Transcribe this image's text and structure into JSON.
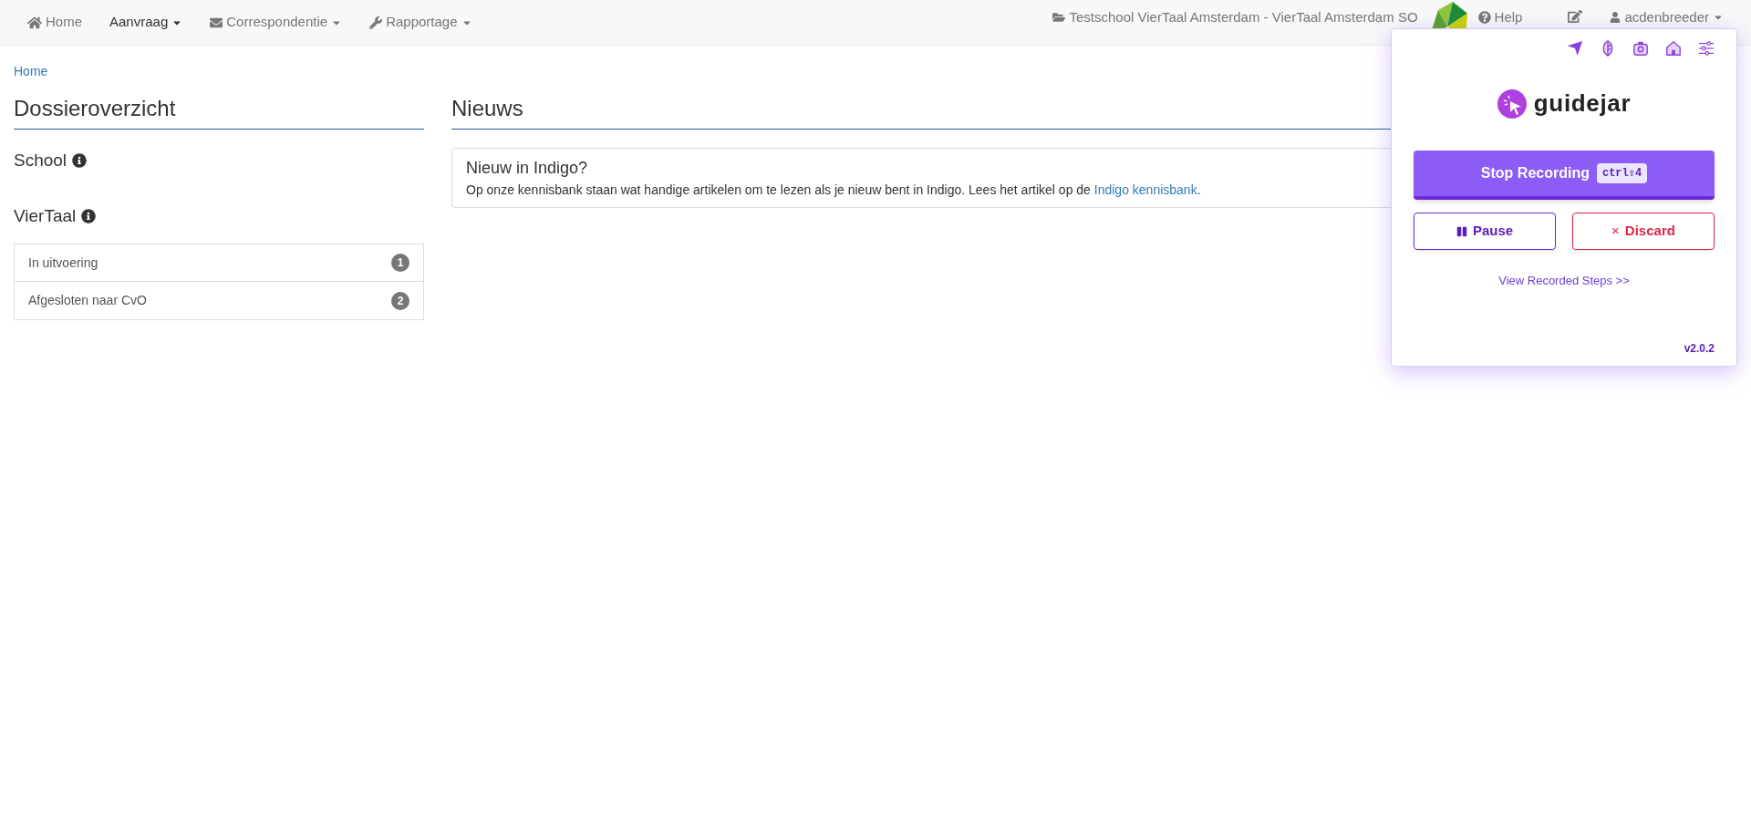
{
  "navbar": {
    "items": [
      {
        "label": "Home",
        "selected": false,
        "dropdown": false
      },
      {
        "label": "Aanvraag",
        "selected": true,
        "dropdown": true
      },
      {
        "label": "Correspondentie",
        "selected": false,
        "dropdown": true
      },
      {
        "label": "Rapportage",
        "selected": false,
        "dropdown": true
      }
    ],
    "school": "Testschool VierTaal Amsterdam - VierTaal Amsterdam SO",
    "help": "Help",
    "user": "acdenbreeder"
  },
  "breadcrumb": "Home",
  "dossier": {
    "title": "Dossieroverzicht",
    "sections": [
      {
        "title": "School"
      },
      {
        "title": "VierTaal",
        "rows": [
          {
            "label": "In uitvoering",
            "count": "1"
          },
          {
            "label": "Afgesloten naar CvO",
            "count": "2"
          }
        ]
      }
    ]
  },
  "news": {
    "title": "Nieuws",
    "items": [
      {
        "title": "Nieuw in Indigo?",
        "text": "Op onze kennisbank staan wat handige artikelen om te lezen als je nieuw bent in Indigo. Lees het artikel op de ",
        "link": "Indigo kennisbank",
        "after": "."
      }
    ]
  },
  "recorder": {
    "logo": "guidejar",
    "stop": "Stop Recording",
    "shortcut": "ctrl⇧4",
    "pause": "Pause",
    "discard": "Discard",
    "discard_mark": "×",
    "steps_link": "View Recorded Steps >>",
    "version": "v2.0.2"
  }
}
